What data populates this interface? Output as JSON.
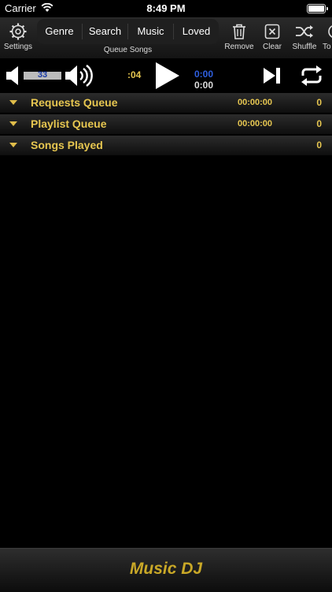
{
  "status_bar": {
    "carrier": "Carrier",
    "time": "8:49 PM"
  },
  "toolbar": {
    "settings_label": "Settings",
    "segments": [
      "Genre",
      "Search",
      "Music",
      "Loved"
    ],
    "queue_songs_label": "Queue Songs",
    "remove_label": "Remove",
    "clear_label": "Clear",
    "shuffle_label": "Shuffle",
    "top_label": "To"
  },
  "player": {
    "volume": "33",
    "elapsed": ":04",
    "time_primary": "0:00",
    "time_secondary": "0:00"
  },
  "queues": [
    {
      "name": "Requests Queue",
      "duration": "00:00:00",
      "count": "0"
    },
    {
      "name": "Playlist Queue",
      "duration": "00:00:00",
      "count": "0"
    },
    {
      "name": "Songs Played",
      "duration": "",
      "count": "0"
    }
  ],
  "footer": {
    "brand": "Music DJ"
  },
  "colors": {
    "accent_gold": "#e6c650",
    "time_blue": "#2f5fe0",
    "brand_gold": "#c9a827"
  }
}
